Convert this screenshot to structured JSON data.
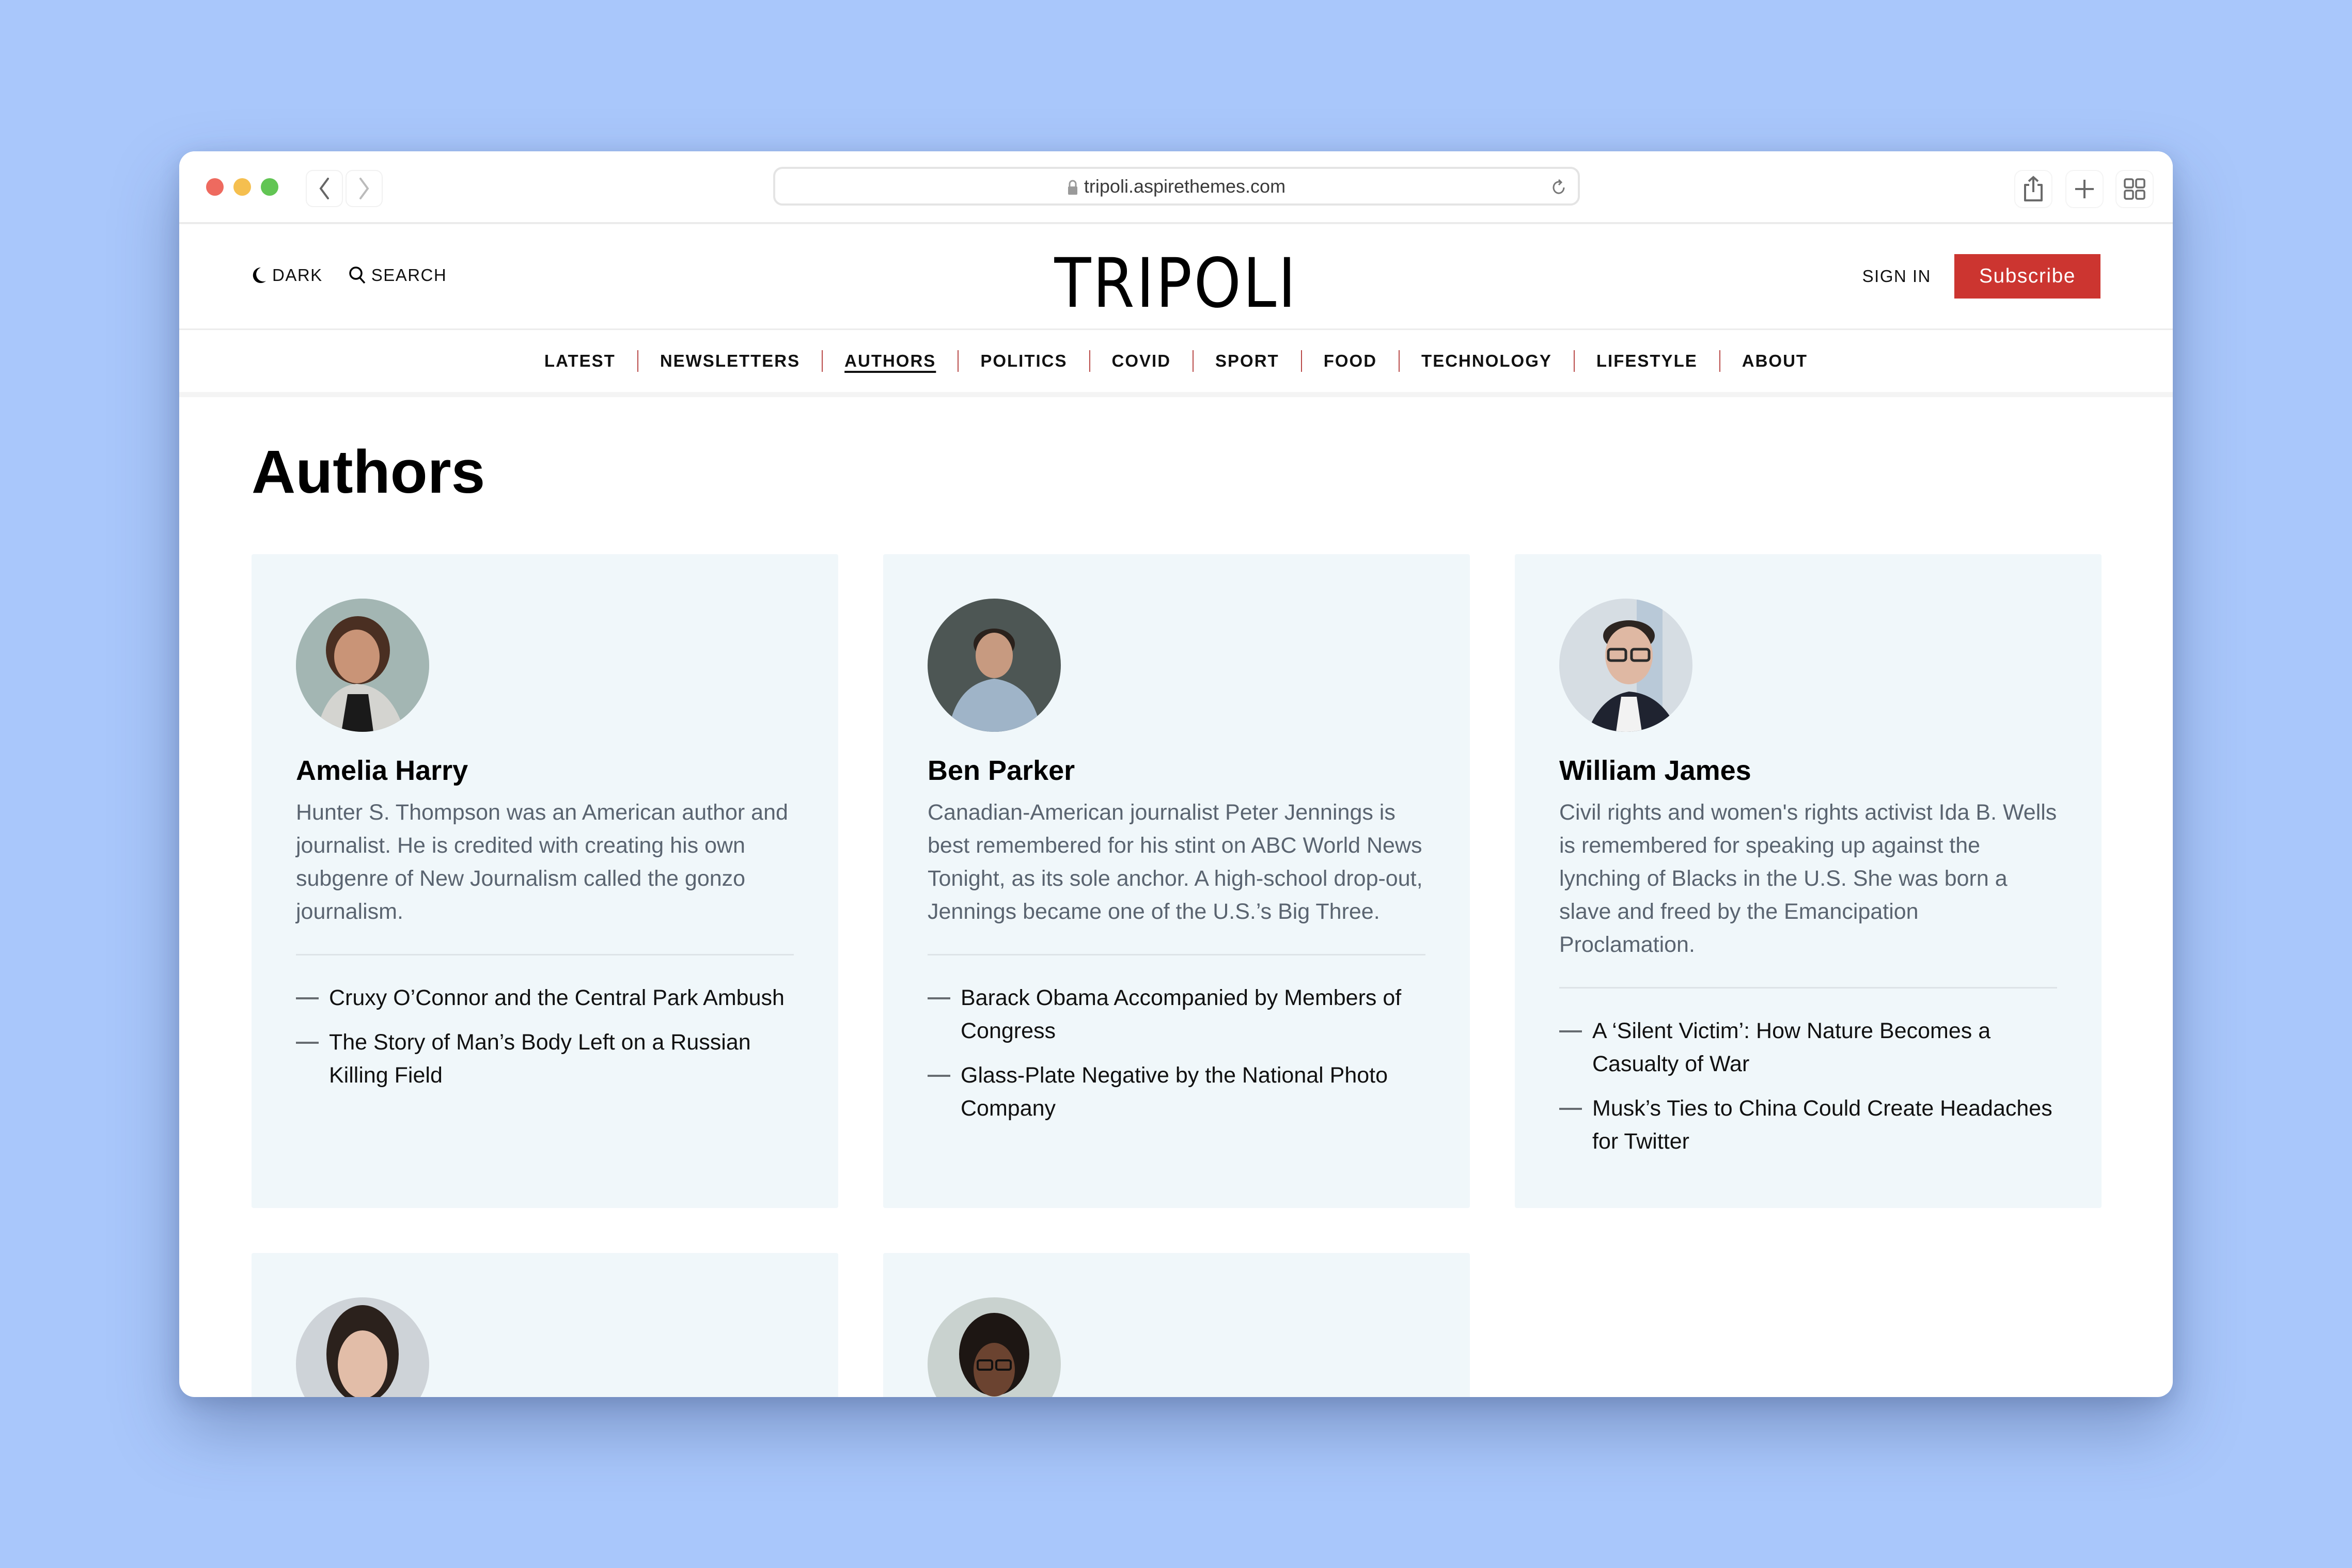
{
  "browser": {
    "url": "tripoli.aspirethemes.com",
    "icons": {
      "back": "chevron-left-icon",
      "forward": "chevron-right-icon",
      "lock": "lock-icon",
      "reload": "reload-icon",
      "share": "share-icon",
      "new_tab": "plus-icon",
      "tab_overview": "grid-icon"
    }
  },
  "header": {
    "dark_label": "DARK",
    "search_label": "SEARCH",
    "logo": "TRIPOLI",
    "sign_in_label": "SIGN IN",
    "subscribe_label": "Subscribe",
    "accent_color": "#cc3530"
  },
  "nav": {
    "items": [
      {
        "label": "LATEST",
        "active": false
      },
      {
        "label": "NEWSLETTERS",
        "active": false
      },
      {
        "label": "AUTHORS",
        "active": true
      },
      {
        "label": "POLITICS",
        "active": false
      },
      {
        "label": "COVID",
        "active": false
      },
      {
        "label": "SPORT",
        "active": false
      },
      {
        "label": "FOOD",
        "active": false
      },
      {
        "label": "TECHNOLOGY",
        "active": false
      },
      {
        "label": "LIFESTYLE",
        "active": false
      },
      {
        "label": "ABOUT",
        "active": false
      }
    ]
  },
  "page": {
    "title": "Authors"
  },
  "authors": [
    {
      "name": "Amelia Harry",
      "bio": "Hunter S. Thompson was an American author and journalist. He is credited with creating his own subgenre of New Journalism called the gonzo journalism.",
      "posts": [
        "Cruxy O’Connor and the Central Park Ambush",
        "The Story of Man’s Body Left on a Russian Killing Field"
      ]
    },
    {
      "name": "Ben Parker",
      "bio": "Canadian-American journalist Peter Jennings is best remembered for his stint on ABC World News Tonight, as its sole anchor. A high-school drop-out, Jennings became one of the U.S.’s Big Three.",
      "posts": [
        "Barack Obama Accompanied by Members of Congress",
        "Glass-Plate Negative by the National Photo Company"
      ]
    },
    {
      "name": "William James",
      "bio": "Civil rights and women's rights activist Ida B. Wells is remembered for speaking up against the lynching of Blacks in the U.S. She was born a slave and freed by the Emancipation Proclamation.",
      "posts": [
        "A ‘Silent Victim’: How Nature Becomes a Casualty of War",
        "Musk’s Ties to China Could Create Headaches for Twitter"
      ]
    },
    {
      "name": "",
      "bio": "",
      "posts": []
    },
    {
      "name": "",
      "bio": "",
      "posts": []
    }
  ]
}
